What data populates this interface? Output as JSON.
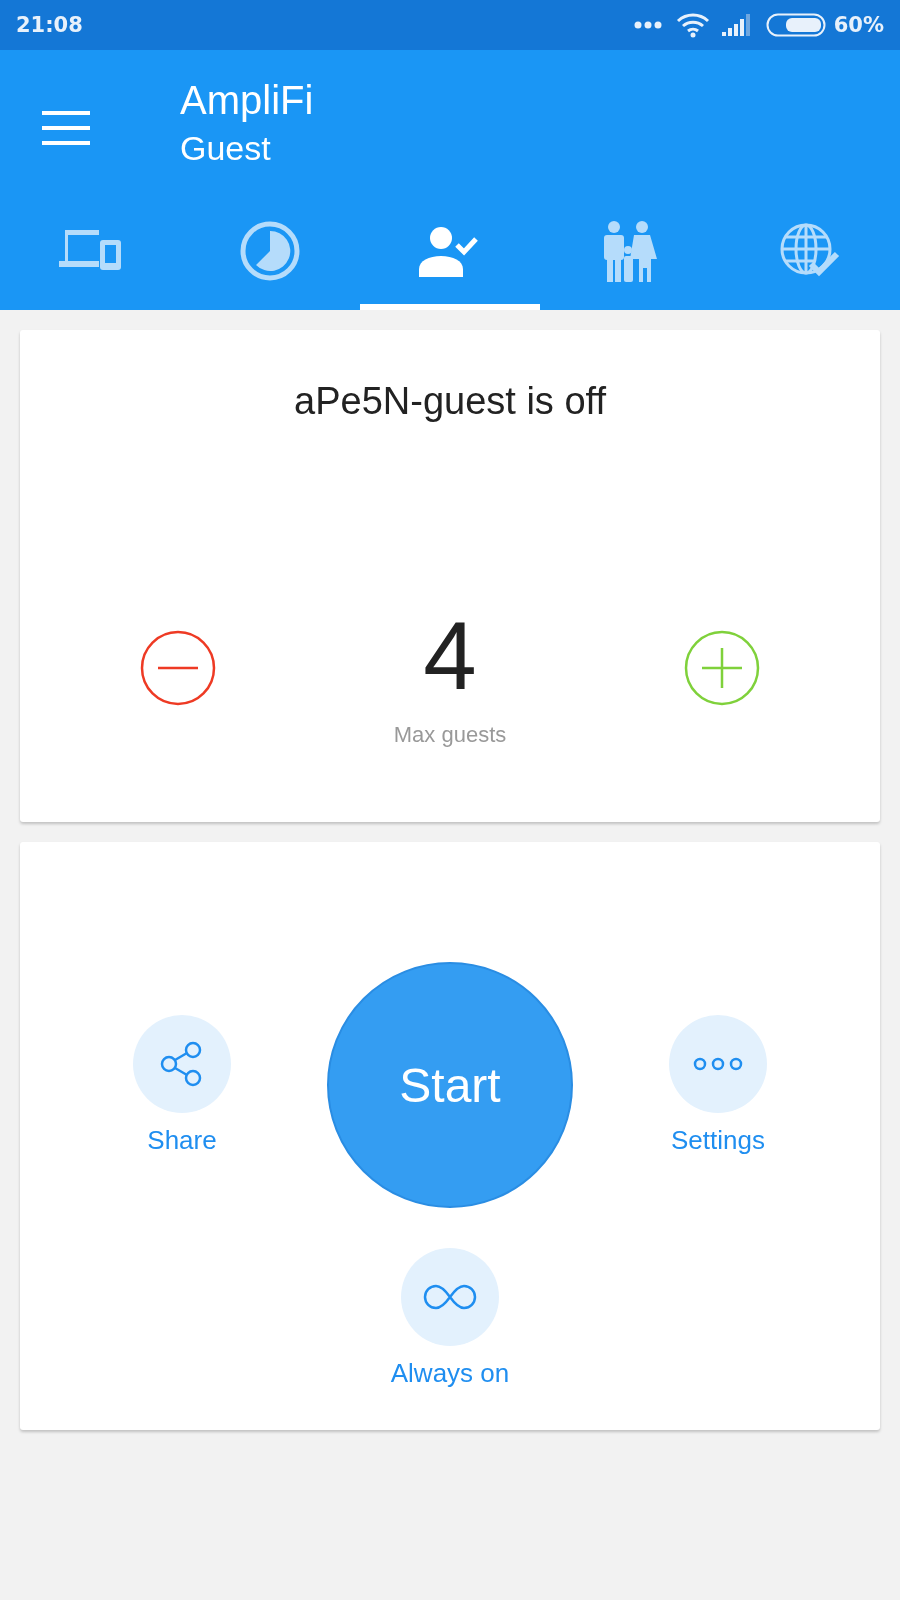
{
  "status_bar": {
    "time": "21:08",
    "battery": "60%"
  },
  "app_bar": {
    "title": "AmpliFi",
    "subtitle": "Guest"
  },
  "tabs": [
    {
      "kind": "devices",
      "selected": false
    },
    {
      "kind": "usage",
      "selected": false
    },
    {
      "kind": "guest",
      "selected": true
    },
    {
      "kind": "family",
      "selected": false
    },
    {
      "kind": "internet",
      "selected": false
    }
  ],
  "guest_card": {
    "title": "aPe5N-guest is off",
    "count": "4",
    "count_label": "Max guests"
  },
  "actions": [
    {
      "kind": "share",
      "label": "Share"
    },
    {
      "kind": "start",
      "label": "Start"
    },
    {
      "kind": "settings",
      "label": "Settings"
    },
    {
      "kind": "always_on",
      "label": "Always on"
    }
  ]
}
